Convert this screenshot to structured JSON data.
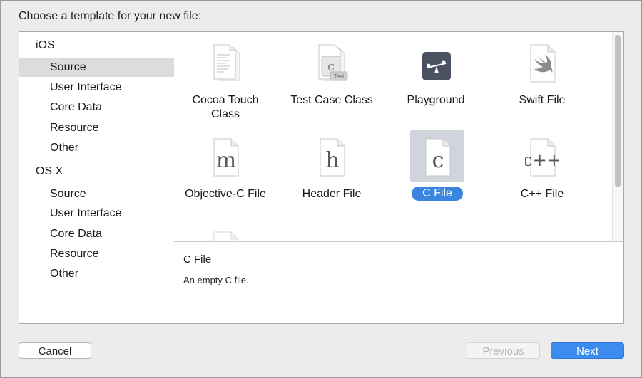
{
  "heading": "Choose a template for your new file:",
  "sidebar": {
    "items": [
      {
        "label": "iOS",
        "kind": "group"
      },
      {
        "label": "Source",
        "kind": "item",
        "selected": true
      },
      {
        "label": "User Interface",
        "kind": "item"
      },
      {
        "label": "Core Data",
        "kind": "item"
      },
      {
        "label": "Resource",
        "kind": "item"
      },
      {
        "label": "Other",
        "kind": "item"
      },
      {
        "label": "OS X",
        "kind": "group"
      },
      {
        "label": "Source",
        "kind": "item"
      },
      {
        "label": "User Interface",
        "kind": "item"
      },
      {
        "label": "Core Data",
        "kind": "item"
      },
      {
        "label": "Resource",
        "kind": "item"
      },
      {
        "label": "Other",
        "kind": "item"
      }
    ]
  },
  "templates": [
    {
      "label": "Cocoa Touch Class",
      "label_line1": "Cocoa Touch",
      "label_line2": "Class",
      "icon": "cocoa-touch-class-icon"
    },
    {
      "label": "Test Case Class",
      "icon": "test-case-class-icon",
      "badge": "Test"
    },
    {
      "label": "Playground",
      "icon": "playground-icon"
    },
    {
      "label": "Swift File",
      "icon": "swift-file-icon"
    },
    {
      "label": "Objective-C File",
      "icon": "objective-c-file-icon",
      "glyph": "m"
    },
    {
      "label": "Header File",
      "icon": "header-file-icon",
      "glyph": "h"
    },
    {
      "label": "C File",
      "icon": "c-file-icon",
      "glyph": "c",
      "selected": true
    },
    {
      "label": "C++ File",
      "icon": "cpp-file-icon",
      "glyph": "c++"
    }
  ],
  "detail": {
    "title": "C File",
    "description": "An empty C file."
  },
  "buttons": {
    "cancel": "Cancel",
    "previous": "Previous",
    "next": "Next"
  },
  "colors": {
    "selection_blue": "#3a85e0",
    "primary_button": "#3c8cf0",
    "sidebar_selected": "#dcdcdc"
  }
}
